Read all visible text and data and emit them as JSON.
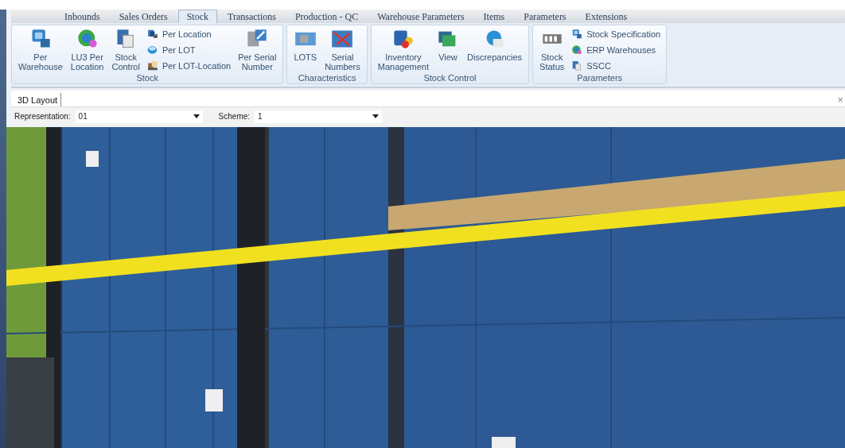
{
  "menu_tabs": [
    {
      "label": "Inbounds",
      "selected": false
    },
    {
      "label": "Sales Orders",
      "selected": false
    },
    {
      "label": "Stock",
      "selected": true
    },
    {
      "label": "Transactions",
      "selected": false
    },
    {
      "label": "Production - QC",
      "selected": false
    },
    {
      "label": "Warehouse Parameters",
      "selected": false
    },
    {
      "label": "Items",
      "selected": false
    },
    {
      "label": "Parameters",
      "selected": false
    },
    {
      "label": "Extensions",
      "selected": false
    }
  ],
  "ribbon": {
    "groups": [
      {
        "title": "Stock",
        "items": [
          {
            "label": "Per\nWarehouse",
            "kind": "large"
          },
          {
            "label": "LU3 Per\nLocation",
            "kind": "large"
          },
          {
            "label": "Stock\nControl",
            "kind": "large"
          },
          {
            "label": "Per Location",
            "kind": "small"
          },
          {
            "label": "Per LOT",
            "kind": "small"
          },
          {
            "label": "Per LOT-Location",
            "kind": "small"
          },
          {
            "label": "Per Serial\nNumber",
            "kind": "large"
          }
        ]
      },
      {
        "title": "Characteristics",
        "items": [
          {
            "label": "LOTS",
            "kind": "large"
          },
          {
            "label": "Serial\nNumbers",
            "kind": "large"
          }
        ]
      },
      {
        "title": "Stock Control",
        "items": [
          {
            "label": "Inventory\nManagement",
            "kind": "large"
          },
          {
            "label": "View",
            "kind": "large"
          },
          {
            "label": "Discrepancies",
            "kind": "large"
          }
        ]
      },
      {
        "title": "Parameters",
        "items": [
          {
            "label": "Stock\nStatus",
            "kind": "large"
          },
          {
            "label": "Stock Specification",
            "kind": "small"
          },
          {
            "label": "ERP Warehouses",
            "kind": "small"
          },
          {
            "label": "SSCC",
            "kind": "small"
          }
        ]
      }
    ]
  },
  "document_tabs": [
    {
      "label": "3D Layout",
      "selected": true
    }
  ],
  "close_button": "×",
  "filters": [
    {
      "label": "Representation:",
      "value": "01"
    },
    {
      "label": "Scheme:",
      "value": "1"
    }
  ]
}
